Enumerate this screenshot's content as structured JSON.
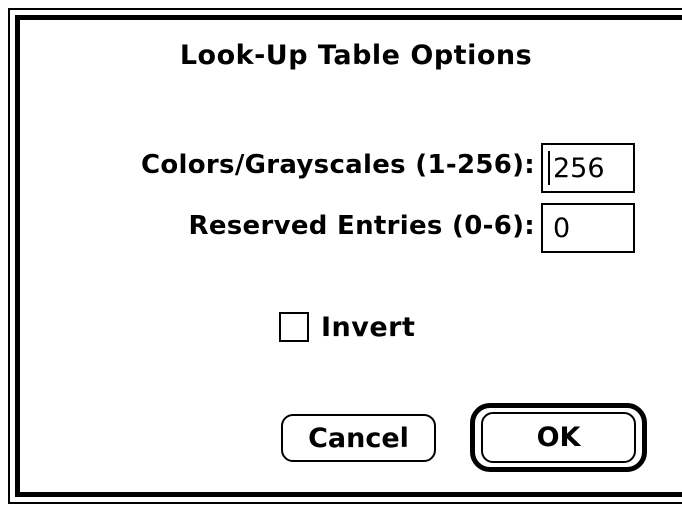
{
  "dialog": {
    "title": "Look-Up Table Options"
  },
  "fields": {
    "colors_label": "Colors/Grayscales (1-256):",
    "colors_value": "256",
    "reserved_label": "Reserved Entries (0-6):",
    "reserved_value": "0"
  },
  "invert": {
    "label": "Invert",
    "checked": false
  },
  "buttons": {
    "cancel_label": "Cancel",
    "ok_label": "OK"
  }
}
